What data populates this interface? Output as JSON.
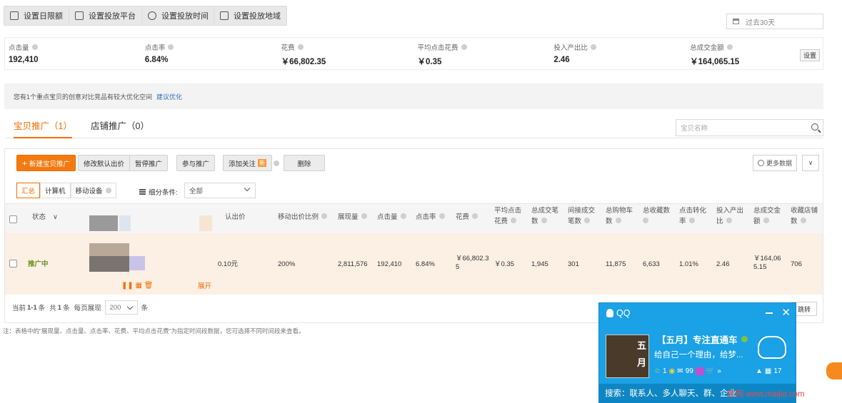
{
  "toolbar": {
    "buttons": [
      "设置日限额",
      "设置投放平台",
      "设置投放时间",
      "设置投放地域"
    ],
    "date_range": "过去30天"
  },
  "metrics": [
    {
      "label": "点击量",
      "value": "192,410"
    },
    {
      "label": "点击率",
      "value": "6.84%"
    },
    {
      "label": "花费",
      "value": "￥66,802.35"
    },
    {
      "label": "平均点击花费",
      "value": "￥0.35"
    },
    {
      "label": "投入产出比",
      "value": "2.46"
    },
    {
      "label": "总成交金额",
      "value": "￥164,065.15"
    }
  ],
  "metrics_setting": "设置",
  "tip": {
    "text": "您有1个重点宝贝的创意对比竞品有较大优化空间",
    "link": "建议优化"
  },
  "tabs": [
    {
      "label": "宝贝推广（1）",
      "active": true
    },
    {
      "label": "店铺推广（0）",
      "active": false
    }
  ],
  "search": {
    "placeholder": "宝贝名称"
  },
  "actions": {
    "new": "新建宝贝推广",
    "modify": "修改默认出价",
    "pause": "暂停推广",
    "join": "参与推广",
    "follow": "添加关注",
    "follow_badge": "新",
    "delete": "删除",
    "more_data": "更多数据"
  },
  "segments": [
    "汇总",
    "计算机",
    "移动设备"
  ],
  "filter": {
    "label": "细分条件:",
    "value": "全部"
  },
  "table": {
    "headers": {
      "status": "状态",
      "bid": "认出价",
      "mobile_ratio": "移动出价比例",
      "impressions": "展现量",
      "clicks": "点击量",
      "ctr": "点击率",
      "cost": "花费",
      "avg_cpc_1": "平均点击",
      "avg_cpc_2": "花费",
      "direct_1": "总成交笔",
      "direct_2": "数",
      "indirect_1": "间接成交",
      "indirect_2": "笔数",
      "cart_1": "总购物车",
      "cart_2": "数",
      "fav_1": "总收藏数",
      "conv_1": "点击转化",
      "conv_2": "率",
      "roi_1": "投入产出",
      "roi_2": "比",
      "gmv_1": "总成交金",
      "gmv_2": "额",
      "store_fav_1": "收藏店铺",
      "store_fav_2": "数"
    },
    "row": {
      "status": "推广中",
      "expand": "展开",
      "bid": "0.10元",
      "mobile_ratio": "200%",
      "impressions": "2,811,576",
      "clicks": "192,410",
      "ctr": "6.84%",
      "cost_1": "￥66,802.3",
      "cost_2": "5",
      "avg_cpc": "￥0.35",
      "direct": "1,945",
      "indirect": "301",
      "cart": "11,875",
      "fav": "6,633",
      "conv": "1.01%",
      "roi": "2.46",
      "gmv_1": "￥164,06",
      "gmv_2": "5.15",
      "store_fav": "706"
    }
  },
  "pagination": {
    "current": "当前",
    "range": "1-1",
    "unit1": "条",
    "total_prefix": "共",
    "total": "1",
    "unit2": "条",
    "per_page": "每页展现",
    "size": "200",
    "unit3": "条",
    "jump": "跳转"
  },
  "note": "注：表格中的\"展现量、点击量、点击率、花费、平均点击花费\"为指定时间段数据，您可选择不同时间段来查看。",
  "qq_popup": {
    "app": "QQ",
    "nickname": "【五月】专注直通车",
    "signature": "给自己一个理由，给梦...",
    "avatar_text_1": "五",
    "avatar_text_2": "月",
    "count_star": "1",
    "count_mail": "99",
    "count_right": "17",
    "search": "搜索：联系人、多人聊天、群、企业"
  },
  "watermark": "家网 www.maijia.com"
}
